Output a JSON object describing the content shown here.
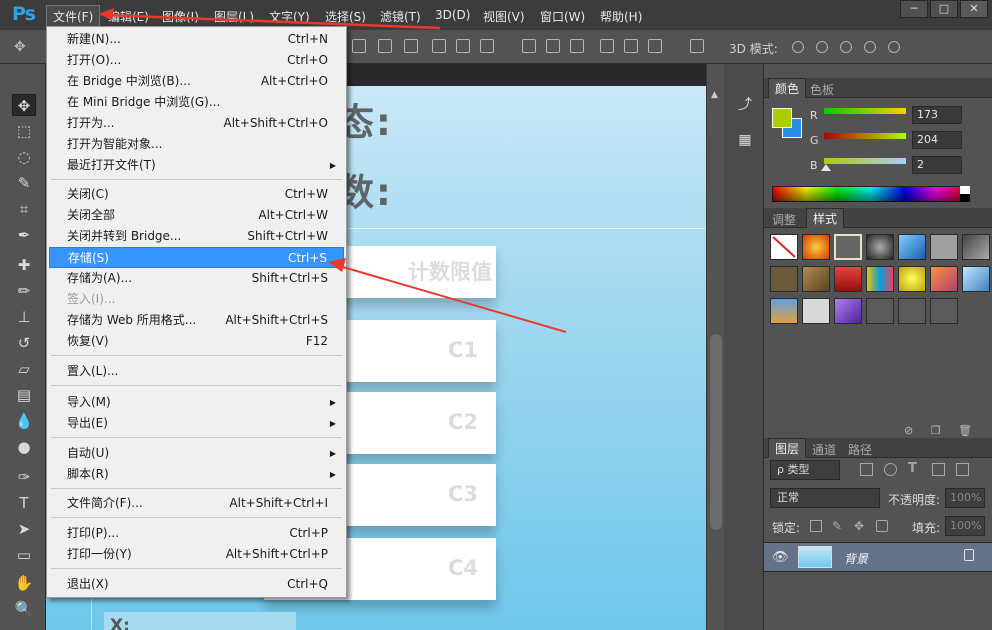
{
  "app": {
    "logo": "Ps",
    "menus": [
      "文件(F)",
      "编辑(E)",
      "图像(I)",
      "图层(L)",
      "文字(Y)",
      "选择(S)",
      "滤镜(T)",
      "3D(D)",
      "视图(V)",
      "窗口(W)",
      "帮助(H)"
    ],
    "window_buttons": [
      "─",
      "□",
      "✕"
    ]
  },
  "options_bar": {
    "mode3d_label": "3D 模式:"
  },
  "file_menu": {
    "items": [
      {
        "label": "新建(N)...",
        "shortcut": "Ctrl+N"
      },
      {
        "label": "打开(O)...",
        "shortcut": "Ctrl+O"
      },
      {
        "label": "在 Bridge 中浏览(B)...",
        "shortcut": "Alt+Ctrl+O"
      },
      {
        "label": "在 Mini Bridge 中浏览(G)...",
        "shortcut": ""
      },
      {
        "label": "打开为...",
        "shortcut": "Alt+Shift+Ctrl+O"
      },
      {
        "label": "打开为智能对象...",
        "shortcut": ""
      },
      {
        "label": "最近打开文件(T)",
        "shortcut": ""
      },
      {
        "label": "关闭(C)",
        "shortcut": "Ctrl+W"
      },
      {
        "label": "关闭全部",
        "shortcut": "Alt+Ctrl+W"
      },
      {
        "label": "关闭并转到 Bridge...",
        "shortcut": "Shift+Ctrl+W"
      },
      {
        "label": "存储(S)",
        "shortcut": "Ctrl+S"
      },
      {
        "label": "存储为(A)...",
        "shortcut": "Shift+Ctrl+S"
      },
      {
        "label": "签入(I)...",
        "shortcut": ""
      },
      {
        "label": "存储为 Web 所用格式...",
        "shortcut": "Alt+Shift+Ctrl+S"
      },
      {
        "label": "恢复(V)",
        "shortcut": "F12"
      },
      {
        "label": "置入(L)...",
        "shortcut": ""
      },
      {
        "label": "导入(M)",
        "shortcut": ""
      },
      {
        "label": "导出(E)",
        "shortcut": ""
      },
      {
        "label": "自动(U)",
        "shortcut": ""
      },
      {
        "label": "脚本(R)",
        "shortcut": ""
      },
      {
        "label": "文件简介(F)...",
        "shortcut": "Alt+Shift+Ctrl+I"
      },
      {
        "label": "打印(P)...",
        "shortcut": "Ctrl+P"
      },
      {
        "label": "打印一份(Y)",
        "shortcut": "Alt+Shift+Ctrl+P"
      },
      {
        "label": "退出(X)",
        "shortcut": "Ctrl+Q"
      }
    ],
    "highlighted": "存储(S)"
  },
  "canvas": {
    "label_status": "状态:",
    "label_count": "计数:",
    "card_header": "计数限值",
    "cards": [
      "C1",
      "C2",
      "C3",
      "C4"
    ],
    "bottom_text": "X:"
  },
  "color_panel": {
    "tabs": [
      "颜色",
      "色板"
    ],
    "channels": [
      {
        "name": "R",
        "value": "173"
      },
      {
        "name": "G",
        "value": "204"
      },
      {
        "name": "B",
        "value": "2"
      }
    ],
    "foreground": "#adcc02",
    "background": "#2b8fe8"
  },
  "styles_panel": {
    "tabs": [
      "调整",
      "样式"
    ]
  },
  "layers_panel": {
    "tabs": [
      "图层",
      "通道",
      "路径"
    ],
    "filter_kind": "ρ 类型",
    "blend_mode": "正常",
    "opacity_label": "不透明度:",
    "opacity_value": "100%",
    "lock_label": "锁定:",
    "fill_label": "填充:",
    "fill_value": "100%",
    "layer_name": "背景"
  },
  "colors": {
    "accent": "#3794fb",
    "annotation": "#e8392b",
    "ps_blue": "#2fa3e6"
  }
}
